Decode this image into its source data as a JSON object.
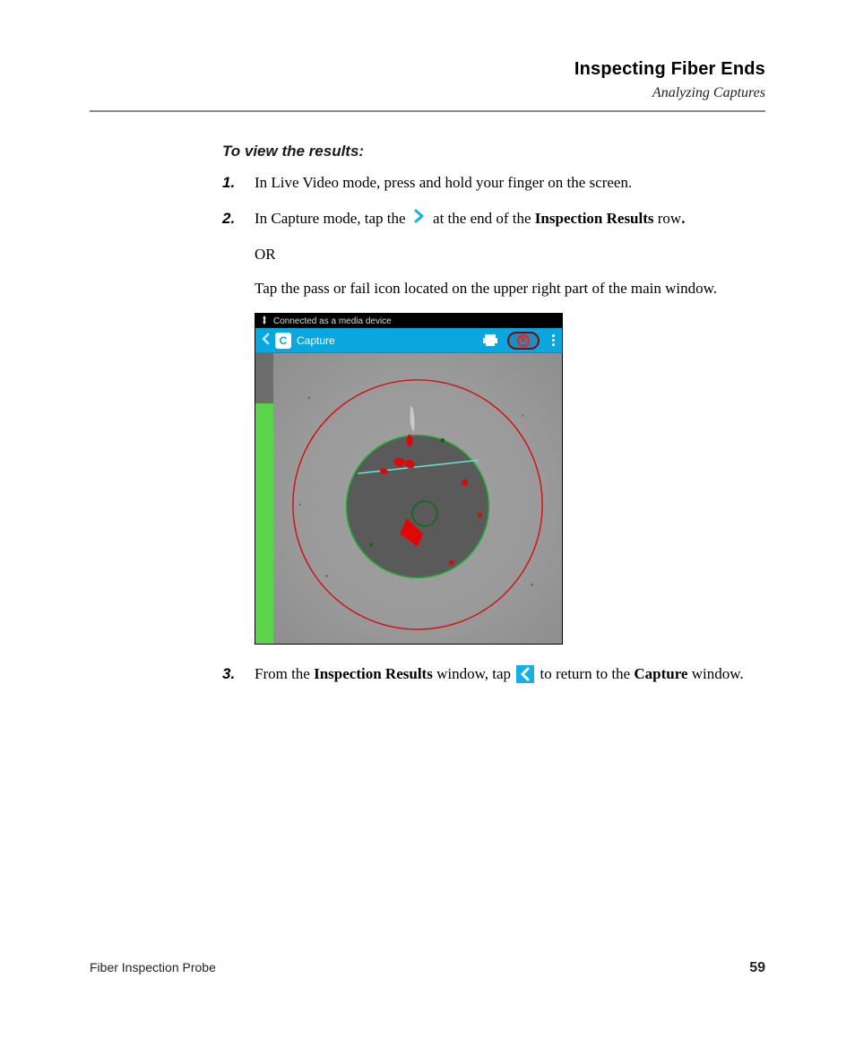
{
  "header": {
    "chapter_title": "Inspecting Fiber Ends",
    "section_title": "Analyzing Captures"
  },
  "subhead": "To view the results:",
  "steps": {
    "s1": {
      "num": "1.",
      "text": "In Live Video mode, press and hold your finger on the screen."
    },
    "s2": {
      "num": "2.",
      "pre": "In Capture mode, tap the ",
      "mid": " at the end of the ",
      "bold1": "Inspection Results",
      "post": " row",
      "period": ".",
      "or": "OR",
      "tail": "Tap the pass or fail icon located on the upper right part of the main window."
    },
    "s3": {
      "num": "3.",
      "pre": "From the ",
      "bold1": "Inspection Results",
      "mid": " window, tap ",
      "post": " to return to the ",
      "bold2": "Capture",
      "tail": " window."
    }
  },
  "screenshot": {
    "statusbar_text": "Connected as a media device",
    "app_logo_letter": "C",
    "app_title": "Capture",
    "fail_glyph": "✕"
  },
  "footer": {
    "doc_title": "Fiber Inspection Probe",
    "page_number": "59"
  },
  "colors": {
    "appbar": "#0aa6e0",
    "fail_ring": "#7e0b0b",
    "fail_x": "#ff1a1a",
    "sidebar_green": "#5bd34b"
  }
}
